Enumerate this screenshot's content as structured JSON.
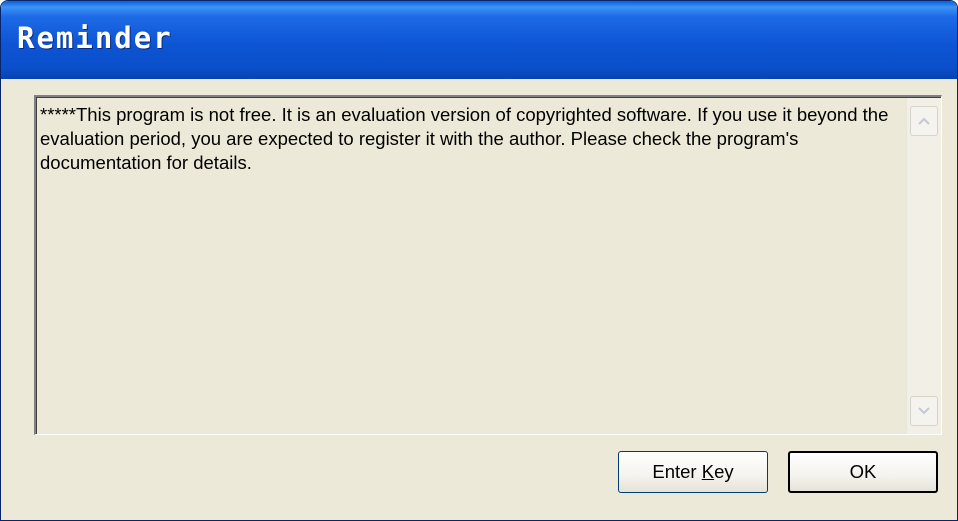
{
  "window": {
    "title": "Reminder"
  },
  "message": {
    "text": "*****This program is not free. It is an evaluation version of copyrighted software. If you use it beyond the evaluation period, you are expected to register it with the author. Please check the program's documentation for details."
  },
  "scrollbar": {
    "up_icon": "chevron-up-icon",
    "down_icon": "chevron-down-icon"
  },
  "buttons": {
    "enter_key": {
      "before": "Enter ",
      "accel": "K",
      "after": "ey"
    },
    "ok": "OK"
  },
  "colors": {
    "titlebar": "#0a4fcb",
    "dialog_background": "#ece9d8",
    "button_border": "#003c74"
  }
}
